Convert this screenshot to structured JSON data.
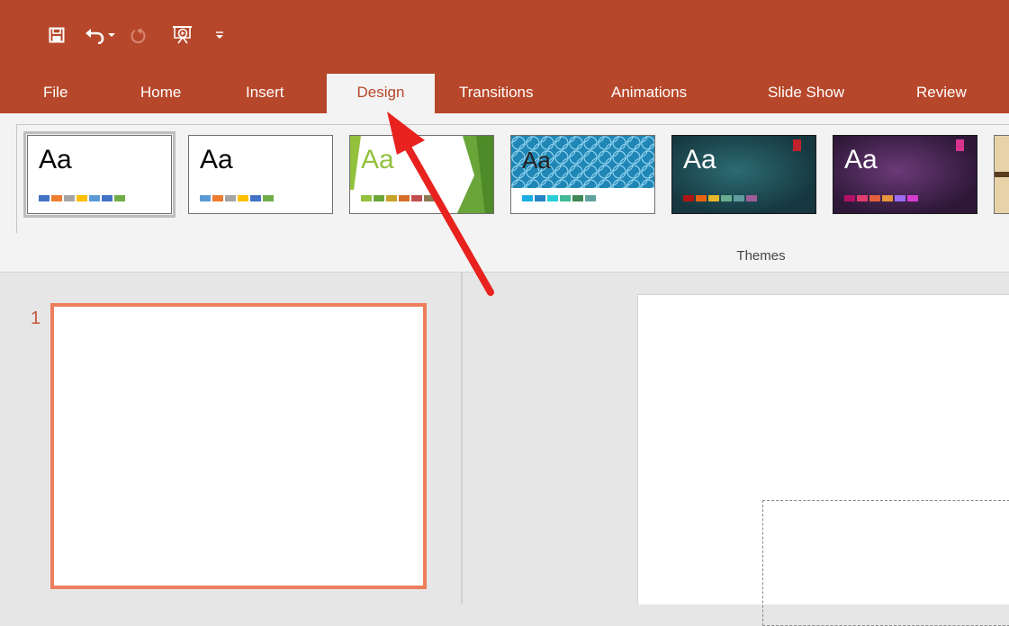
{
  "quick_access": {
    "icons": [
      "save-icon",
      "undo-icon",
      "undo-dropdown-icon",
      "redo-icon",
      "start-from-beginning-icon",
      "customize-qat-icon"
    ]
  },
  "ribbon_tabs": {
    "file": "File",
    "home": "Home",
    "insert": "Insert",
    "design": "Design",
    "transitions": "Transitions",
    "animations": "Animations",
    "slide_show": "Slide Show",
    "review": "Review"
  },
  "themes": {
    "group_label": "Themes",
    "items": [
      {
        "aa": "Aa",
        "colors": [
          "#4472c4",
          "#ed7d31",
          "#a5a5a5",
          "#ffc000",
          "#5b9bd5",
          "#4472c4",
          "#70ad47"
        ]
      },
      {
        "aa": "Aa",
        "colors": [
          "#5b9bd5",
          "#ed7d31",
          "#a5a5a5",
          "#ffc000",
          "#4472c4",
          "#70ad47"
        ]
      },
      {
        "aa": "Aa",
        "colors": [
          "#93c13d",
          "#6aa53a",
          "#c9a22a",
          "#d56f2a",
          "#c0504d",
          "#8c7a54"
        ]
      },
      {
        "aa": "Aa",
        "colors": [
          "#1cade4",
          "#2683c6",
          "#27ced7",
          "#42ba97",
          "#3e8853",
          "#62a39f"
        ]
      },
      {
        "aa": "Aa",
        "colors": [
          "#e84c22",
          "#ffbd47",
          "#b64926",
          "#ff8427",
          "#cc9900",
          "#b22600"
        ]
      },
      {
        "aa": "Aa",
        "colors": [
          "#e32d91",
          "#c830cc",
          "#4ea6dc",
          "#4775e7",
          "#8971e1",
          "#d54773"
        ]
      }
    ]
  },
  "slides": {
    "number": "1"
  },
  "colors": {
    "accent": "#b7472a",
    "thumbnail_border": "#ed7e5c",
    "annotation_arrow": "#e8221e"
  }
}
